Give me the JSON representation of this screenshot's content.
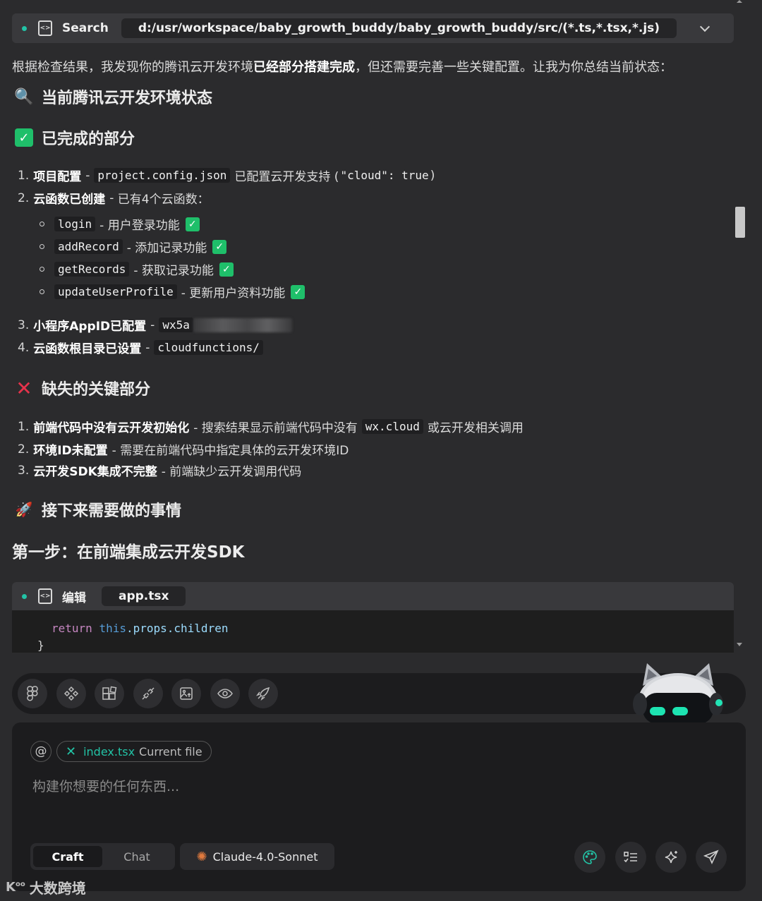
{
  "tool_call": {
    "label": "Search",
    "path": "d:/usr/workspace/baby_growth_buddy/baby_growth_buddy/src/(*.ts,*.tsx,*.js)"
  },
  "intro": {
    "pre": "根据检查结果，我发现你的腾讯云开发环境",
    "bold": "已经部分搭建完成",
    "post": "，但还需要完善一些关键配置。让我为你总结当前状态："
  },
  "heading_status": {
    "icon": "magnifier-icon",
    "text": "当前腾讯云开发环境状态"
  },
  "heading_done": {
    "icon": "check-icon",
    "text": "已完成的部分"
  },
  "done_items": [
    {
      "num": "1.",
      "title": "项目配置",
      "sep": "-",
      "code": "project.config.json",
      "desc": "已配置云开发支持 (",
      "code2": "\"cloud\": true",
      "desc2": ")"
    },
    {
      "num": "2.",
      "title": "云函数已创建",
      "sep": "-",
      "desc": "已有4个云函数："
    }
  ],
  "functions": [
    {
      "name": "login",
      "desc": "- 用户登录功能"
    },
    {
      "name": "addRecord",
      "desc": "- 添加记录功能"
    },
    {
      "name": "getRecords",
      "desc": "- 获取记录功能"
    },
    {
      "name": "updateUserProfile",
      "desc": "- 更新用户资料功能"
    }
  ],
  "done_items_2": [
    {
      "num": "3.",
      "title": "小程序AppID已配置",
      "sep": "-",
      "code": "wx5a"
    },
    {
      "num": "4.",
      "title": "云函数根目录已设置",
      "sep": "-",
      "code": "cloudfunctions/"
    }
  ],
  "heading_missing": {
    "icon": "cross-icon",
    "text": "缺失的关键部分"
  },
  "missing_items": [
    {
      "num": "1.",
      "title": "前端代码中没有云开发初始化",
      "desc": "- 搜索结果显示前端代码中没有",
      "code": "wx.cloud",
      "desc2": "或云开发相关调用"
    },
    {
      "num": "2.",
      "title": "环境ID未配置",
      "desc": "- 需要在前端代码中指定具体的云开发环境ID"
    },
    {
      "num": "3.",
      "title": "云开发SDK集成不完整",
      "desc": "- 前端缺少云开发调用代码"
    }
  ],
  "heading_next": {
    "icon": "rocket-icon",
    "text": "接下来需要做的事情"
  },
  "step_one": "第一步：在前端集成云开发SDK",
  "edit_block": {
    "label": "编辑",
    "file": "app.tsx",
    "code_kw": "return",
    "code_this": "this",
    "code_rest": ".props.children",
    "code_brace": "}"
  },
  "toolbar_icons": [
    "figma-icon",
    "component-icon",
    "blocks-icon",
    "plugin-icon",
    "image-upload-icon",
    "eye-icon",
    "rocket-icon"
  ],
  "composer": {
    "at_symbol": "@",
    "context_file": "index.tsx",
    "context_hint": "Current file",
    "placeholder": "构建你想要的任何东西...",
    "modes": [
      "Craft",
      "Chat"
    ],
    "active_mode": "Craft",
    "model": "Claude-4.0-Sonnet"
  },
  "watermark": "大数跨境",
  "colors": {
    "accent": "#22c3a6",
    "check": "#1fbf6a",
    "cross": "#e5334b",
    "background": "#2b2b2d"
  }
}
